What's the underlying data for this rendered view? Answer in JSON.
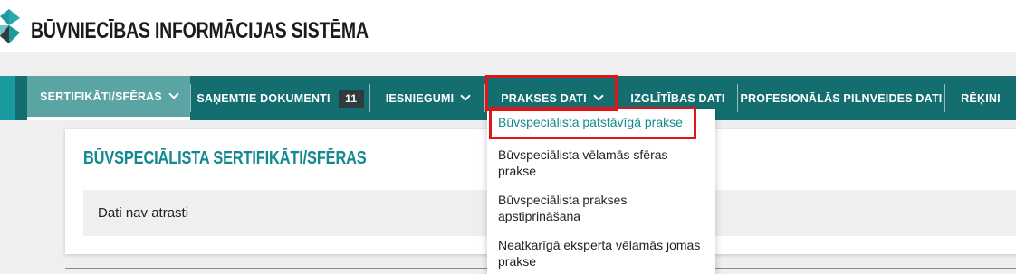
{
  "header": {
    "site_title": "BŪVNIECĪBAS INFORMĀCIJAS SISTĒMA"
  },
  "nav": {
    "items": [
      {
        "label": "SERTIFIKĀTI/SFĒRAS",
        "has_chevron": true,
        "active": true
      },
      {
        "label": "SAŅEMTIE DOKUMENTI",
        "badge": "11"
      },
      {
        "label": "IESNIEGUMI",
        "has_chevron": true
      },
      {
        "label": "PRAKSES DATI",
        "has_chevron": true
      },
      {
        "label": "IZGLĪTĪBAS DATI"
      },
      {
        "label": "PROFESIONĀLĀS PILNVEIDES DATI"
      },
      {
        "label": "RĒĶINI"
      }
    ]
  },
  "dropdown": {
    "items": [
      {
        "label": "Būvspeciālista patstāvīgā prakse"
      },
      {
        "label": "Būvspeciālista vēlamās sfēras prakse"
      },
      {
        "label": "Būvspeciālista prakses apstiprināšana"
      },
      {
        "label": "Neatkarīgā eksperta vēlamās jomas prakse"
      }
    ]
  },
  "main": {
    "title": "BŪVSPECIĀLISTA SERTIFIKĀTI/SFĒRAS",
    "empty_message": "Dati nav atrasti"
  },
  "colors": {
    "nav_bg": "#146e70",
    "nav_active": "#5aa4a3",
    "accent": "#13898f",
    "highlight": "#e0151a"
  },
  "icons": {
    "logo": "bis-logo-icon",
    "chevron": "chevron-down-icon"
  }
}
